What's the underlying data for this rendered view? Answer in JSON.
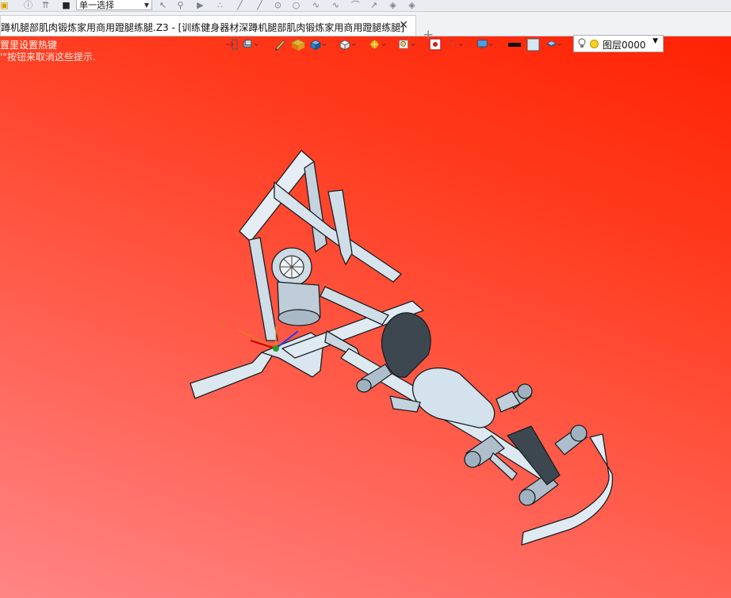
{
  "toolbar_top": {
    "selection_mode": "单一选择",
    "icons": [
      "info-icon",
      "pin-icon",
      "stop-icon",
      "cursor-icon",
      "filter-icon",
      "play-icon",
      "points-icon",
      "line-icon",
      "point-icon",
      "circle-icon",
      "curve-icon",
      "spline-icon",
      "arc-icon",
      "arrow-icon",
      "surface-icon",
      "mesh-icon"
    ]
  },
  "tab": {
    "title": "蹲机腿部肌肉锻炼家用商用蹬腿练腿.Z3 - [训练健身器材深蹲机腿部肌肉锻炼家用商用蹬腿练腿]",
    "close": "✕",
    "new": "+"
  },
  "hints": {
    "line1": "置里设置热键",
    "line2": "'\"按钮来取消这些提示."
  },
  "view_toolbar": {
    "icons": [
      "exit-sketch-icon",
      "display-mode-icon",
      "pen-icon",
      "render-icon",
      "cube-view-icon",
      "iso-view-icon",
      "color-wheel-icon",
      "zoom-icon",
      "inspect-icon",
      "section-icon",
      "monitor-icon",
      "line-color-icon",
      "fill-color-icon",
      "layer-stack-icon"
    ],
    "layer_name": "图层0000",
    "colors": {
      "line": "#111111",
      "fill": "#d6e6f2",
      "accent": "#1e7bd6"
    }
  },
  "axes": {
    "x": "X",
    "y": "Y"
  },
  "colors": {
    "bg_top": "#ff1e00",
    "bg_bottom": "#ff8585",
    "model_fill": "#d9e6ef",
    "model_dark": "#3d4750",
    "model_outline": "#1a1f24"
  }
}
